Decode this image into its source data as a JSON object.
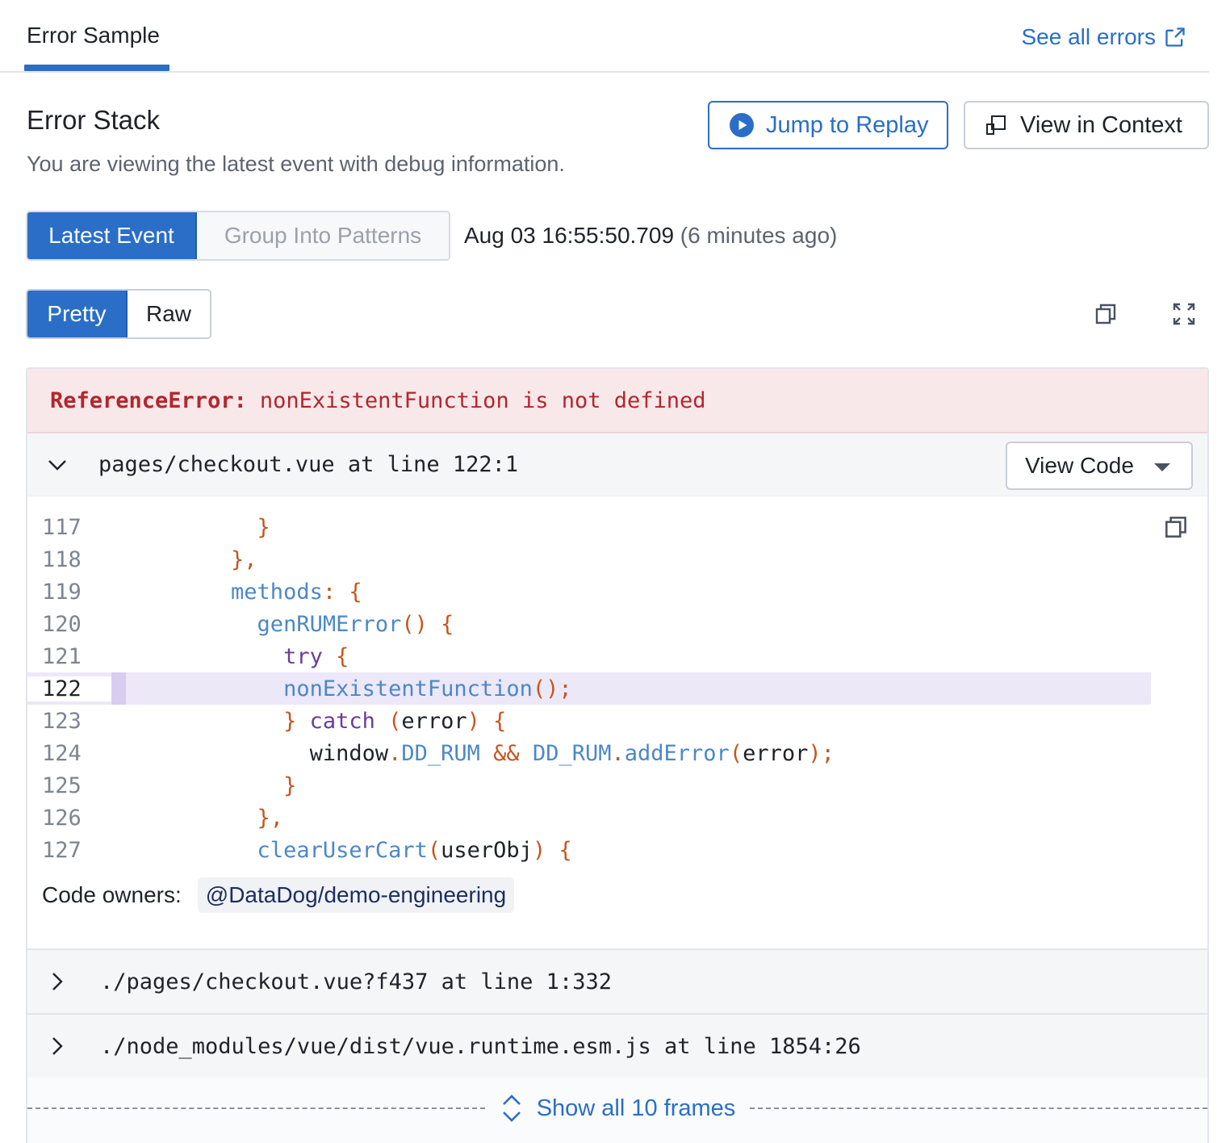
{
  "tabs": {
    "active_label": "Error Sample",
    "see_all_label": "See all errors"
  },
  "header": {
    "title": "Error Stack",
    "subtitle": "You are viewing the latest event with debug information.",
    "replay_button": "Jump to Replay",
    "context_button": "View in Context"
  },
  "event_toggle": {
    "latest": "Latest Event",
    "patterns": "Group Into Patterns"
  },
  "event_time": {
    "timestamp": "Aug 03 16:55:50.709",
    "relative": "(6 minutes ago)"
  },
  "format_toggle": {
    "pretty": "Pretty",
    "raw": "Raw"
  },
  "error": {
    "type": "ReferenceError:",
    "message": "nonExistentFunction is not defined"
  },
  "frame": {
    "path": "pages/checkout.vue at line 122:1",
    "view_code_label": "View Code",
    "lines": [
      {
        "num": "117"
      },
      {
        "num": "118"
      },
      {
        "num": "119"
      },
      {
        "num": "120"
      },
      {
        "num": "121"
      },
      {
        "num": "122"
      },
      {
        "num": "123"
      },
      {
        "num": "124"
      },
      {
        "num": "125"
      },
      {
        "num": "126"
      },
      {
        "num": "127"
      }
    ],
    "code_owners_label": "Code owners:",
    "code_owner": "@DataDog/demo-engineering"
  },
  "collapsed_frames": [
    {
      "path": "./pages/checkout.vue?f437 at line 1:332"
    },
    {
      "path": "./node_modules/vue/dist/vue.runtime.esm.js at line 1854:26"
    }
  ],
  "show_all_label": "Show all 10 frames",
  "colors": {
    "accent": "#2a6ec8",
    "error": "#b3262d",
    "highlight": "#ece8f8"
  }
}
